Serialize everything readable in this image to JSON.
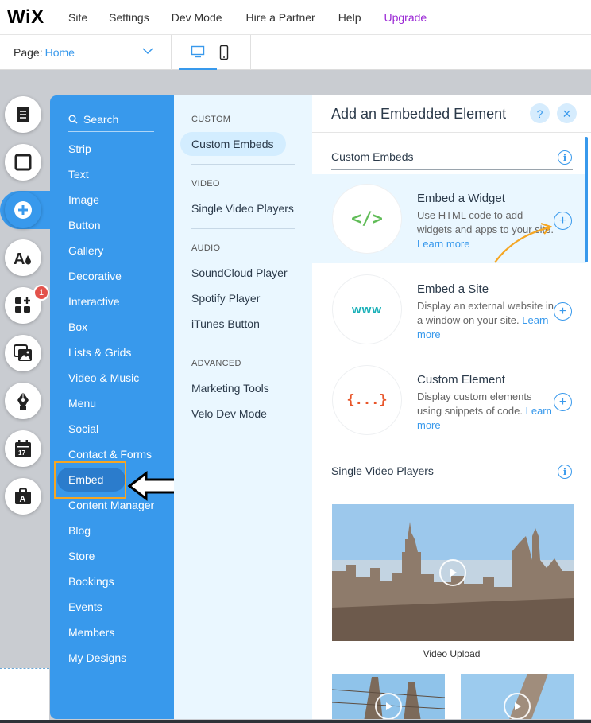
{
  "topbar": {
    "logo": "WiX",
    "nav": [
      "Site",
      "Settings",
      "Dev Mode",
      "Hire a Partner",
      "Help",
      "Upgrade"
    ]
  },
  "subbar": {
    "page_label": "Page:",
    "page_value": "Home"
  },
  "rail": {
    "badge_count": "1"
  },
  "add_panel": {
    "search_label": "Search",
    "categories": [
      "Strip",
      "Text",
      "Image",
      "Button",
      "Gallery",
      "Decorative",
      "Interactive",
      "Box",
      "Lists & Grids",
      "Video & Music",
      "Menu",
      "Social",
      "Contact & Forms",
      "Embed",
      "Content Manager",
      "Blog",
      "Store",
      "Bookings",
      "Events",
      "Members",
      "My Designs"
    ],
    "selected_category": "Embed"
  },
  "sub_panel": {
    "sections": [
      {
        "title": "CUSTOM",
        "items": [
          "Custom Embeds"
        ]
      },
      {
        "title": "VIDEO",
        "items": [
          "Single Video Players"
        ]
      },
      {
        "title": "AUDIO",
        "items": [
          "SoundCloud Player",
          "Spotify Player",
          "iTunes Button"
        ]
      },
      {
        "title": "ADVANCED",
        "items": [
          "Marketing Tools",
          "Velo Dev Mode"
        ]
      }
    ],
    "selected_item": "Custom Embeds"
  },
  "detail_panel": {
    "title": "Add an Embedded Element",
    "help_label": "?",
    "close_label": "×",
    "section1_title": "Custom Embeds",
    "section2_title": "Single Video Players",
    "info_label": "i",
    "items": [
      {
        "title": "Embed a Widget",
        "desc": "Use HTML code to add widgets and apps to your site.",
        "link": "Learn more",
        "icon_text": "</>"
      },
      {
        "title": "Embed a Site",
        "desc": "Display an external website in a window on your site.",
        "link": "Learn more",
        "icon_text": "www"
      },
      {
        "title": "Custom Element",
        "desc": "Display custom elements using snippets of code.",
        "link": "Learn more",
        "icon_text": "{...}"
      }
    ],
    "video_label": "Video Upload"
  },
  "colors": {
    "wix_blue": "#3899ec",
    "panel_blue": "#3899ec",
    "upgrade_purple": "#9a27d5",
    "highlight_orange": "#f5a623",
    "code_green": "#60bc57",
    "www_teal": "#1ab0b8",
    "braces_orange": "#e8562a"
  }
}
